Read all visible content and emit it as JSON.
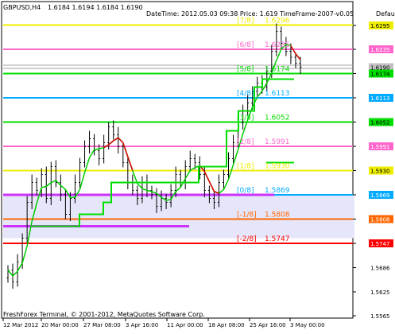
{
  "header": {
    "symbol_label": "GBPUSD,H4",
    "ohlc": "1.6184 1.6194 1.6184 1.6190",
    "indicator_info": "DateTime: 2012.05.03 09:38    Price: 1.619    TimeFrame-2007-v0.05",
    "default_label": "Defau"
  },
  "footer": {
    "copyright": "FreshForex Terminal, © 2001-2012, MetaQuotes Software Corp."
  },
  "colors": {
    "background": "#ffffff",
    "candles": "#000000",
    "ma_green": "#00cc00",
    "ma_red": "#dd0000",
    "band_fill": "#e6e6fa"
  },
  "chart_data": {
    "type": "candlestick",
    "symbol": "GBPUSD",
    "timeframe": "H4",
    "ylim": [
      1.5565,
      1.6315
    ],
    "x_tick_labels": [
      "12 Mar 2012",
      "20 Mar 00:00",
      "27 Mar 08:00",
      "3 Apr 16:00",
      "11 Apr 00:00",
      "18 Apr 08:00",
      "25 Apr 16:00",
      "3 May 00:00"
    ],
    "y_tick_labels": [
      "1.6295",
      "1.6235",
      "1.6174",
      "1.6113",
      "1.6052",
      "1.5991",
      "1.5930",
      "1.5869",
      "1.5808",
      "1.5747",
      "1.5686",
      "1.5625",
      "1.5565"
    ],
    "murrey_levels": [
      {
        "label": "[7/8]",
        "value": "1.6296",
        "price": 1.6296,
        "color": "#eeee00"
      },
      {
        "label": "[6/8]",
        "value": "1.6235",
        "price": 1.6235,
        "color": "#ff66cc"
      },
      {
        "label": "[5/8]",
        "value": "1.6174",
        "price": 1.6174,
        "color": "#00dd00"
      },
      {
        "label": "[4/8]",
        "value": "1.6113",
        "price": 1.6113,
        "color": "#00aaff"
      },
      {
        "label": "[3/8]",
        "value": "1.6052",
        "price": 1.6052,
        "color": "#00dd00"
      },
      {
        "label": "[2/8]",
        "value": "1.5991",
        "price": 1.5991,
        "color": "#ff66cc"
      },
      {
        "label": "[1/8]",
        "value": "1.5930",
        "price": 1.593,
        "color": "#eeee00"
      },
      {
        "label": "[0/8]",
        "value": "1.5869",
        "price": 1.5869,
        "color": "#00aaff"
      },
      {
        "label": "[-1/8]",
        "value": "1.5808",
        "price": 1.5808,
        "color": "#ff6600"
      },
      {
        "label": "[-2/8]",
        "value": "1.5747",
        "price": 1.5747,
        "color": "#ff0000"
      }
    ],
    "price_tags": [
      {
        "text": "1.6295",
        "price": 1.6295,
        "bg": "#eeee00",
        "fg": "#000000"
      },
      {
        "text": "1.6235",
        "price": 1.6235,
        "bg": "#ff66cc",
        "fg": "#ffffff"
      },
      {
        "text": "1.6190",
        "price": 1.619,
        "bg": "#c0c0c0",
        "fg": "#000000"
      },
      {
        "text": "1.6174",
        "price": 1.6174,
        "bg": "#00dd00",
        "fg": "#000000"
      },
      {
        "text": "1.6113",
        "price": 1.6113,
        "bg": "#00aaff",
        "fg": "#ffffff"
      },
      {
        "text": "1.6052",
        "price": 1.6052,
        "bg": "#00dd00",
        "fg": "#000000"
      },
      {
        "text": "1.5991",
        "price": 1.5991,
        "bg": "#ff66cc",
        "fg": "#ffffff"
      },
      {
        "text": "1.5930",
        "price": 1.593,
        "bg": "#eeee00",
        "fg": "#000000"
      },
      {
        "text": "1.5869",
        "price": 1.5869,
        "bg": "#00aaff",
        "fg": "#ffffff"
      },
      {
        "text": "1.5808",
        "price": 1.5808,
        "bg": "#ff6600",
        "fg": "#ffffff"
      },
      {
        "text": "1.5747",
        "price": 1.5747,
        "bg": "#ff0000",
        "fg": "#ffffff"
      }
    ],
    "close_approx": [
      1.568,
      1.565,
      1.57,
      1.576,
      1.585,
      1.59,
      1.588,
      1.592,
      1.586,
      1.594,
      1.59,
      1.587,
      1.582,
      1.586,
      1.59,
      1.595,
      1.599,
      1.601,
      1.598,
      1.596,
      1.6,
      1.604,
      1.602,
      1.599,
      1.595,
      1.59,
      1.588,
      1.586,
      1.59,
      1.588,
      1.587,
      1.584,
      1.586,
      1.585,
      1.588,
      1.592,
      1.59,
      1.594,
      1.596,
      1.595,
      1.592,
      1.588,
      1.586,
      1.585,
      1.59,
      1.592,
      1.596,
      1.6,
      1.605,
      1.608,
      1.61,
      1.613,
      1.615,
      1.614,
      1.618,
      1.623,
      1.628,
      1.625,
      1.623,
      1.6215,
      1.62,
      1.619
    ]
  }
}
